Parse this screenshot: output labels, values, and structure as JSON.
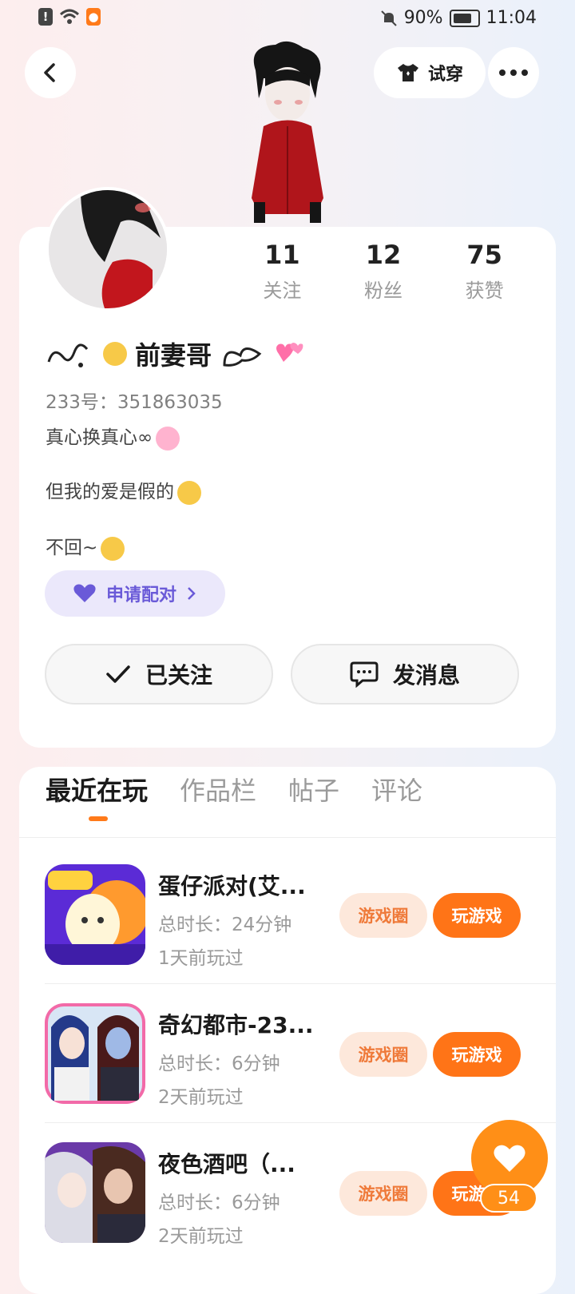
{
  "status_bar": {
    "battery": "90%",
    "time": "11:04"
  },
  "header": {
    "try_on_label": "试穿"
  },
  "profile": {
    "stats": [
      {
        "value": "11",
        "label": "关注"
      },
      {
        "value": "12",
        "label": "粉丝"
      },
      {
        "value": "75",
        "label": "获赞"
      }
    ],
    "nickname": "前妻哥",
    "uid": "233号：351863035",
    "bio_lines": [
      "真心换真心∞",
      "但我的爱是假的",
      "不回~"
    ],
    "pair_label": "申请配对",
    "follow_label": "已关注",
    "message_label": "发消息"
  },
  "tabs": [
    {
      "label": "最近在玩",
      "active": true
    },
    {
      "label": "作品栏",
      "active": false
    },
    {
      "label": "帖子",
      "active": false
    },
    {
      "label": "评论",
      "active": false
    }
  ],
  "games": [
    {
      "title": "蛋仔派对(艾...",
      "duration": "总时长：24分钟",
      "last_played": "1天前玩过",
      "icon": "eggy-party-icon"
    },
    {
      "title": "奇幻都市-23...",
      "duration": "总时长：6分钟",
      "last_played": "2天前玩过",
      "icon": "fantasy-city-icon"
    },
    {
      "title": "夜色酒吧（...",
      "duration": "总时长：6分钟",
      "last_played": "2天前玩过",
      "icon": "night-bar-icon"
    }
  ],
  "game_actions": {
    "circle_label": "游戏圈",
    "play_label": "玩游戏"
  },
  "like": {
    "count": "54"
  },
  "colors": {
    "accent": "#ff7417",
    "pair": "#6a5ad8"
  }
}
